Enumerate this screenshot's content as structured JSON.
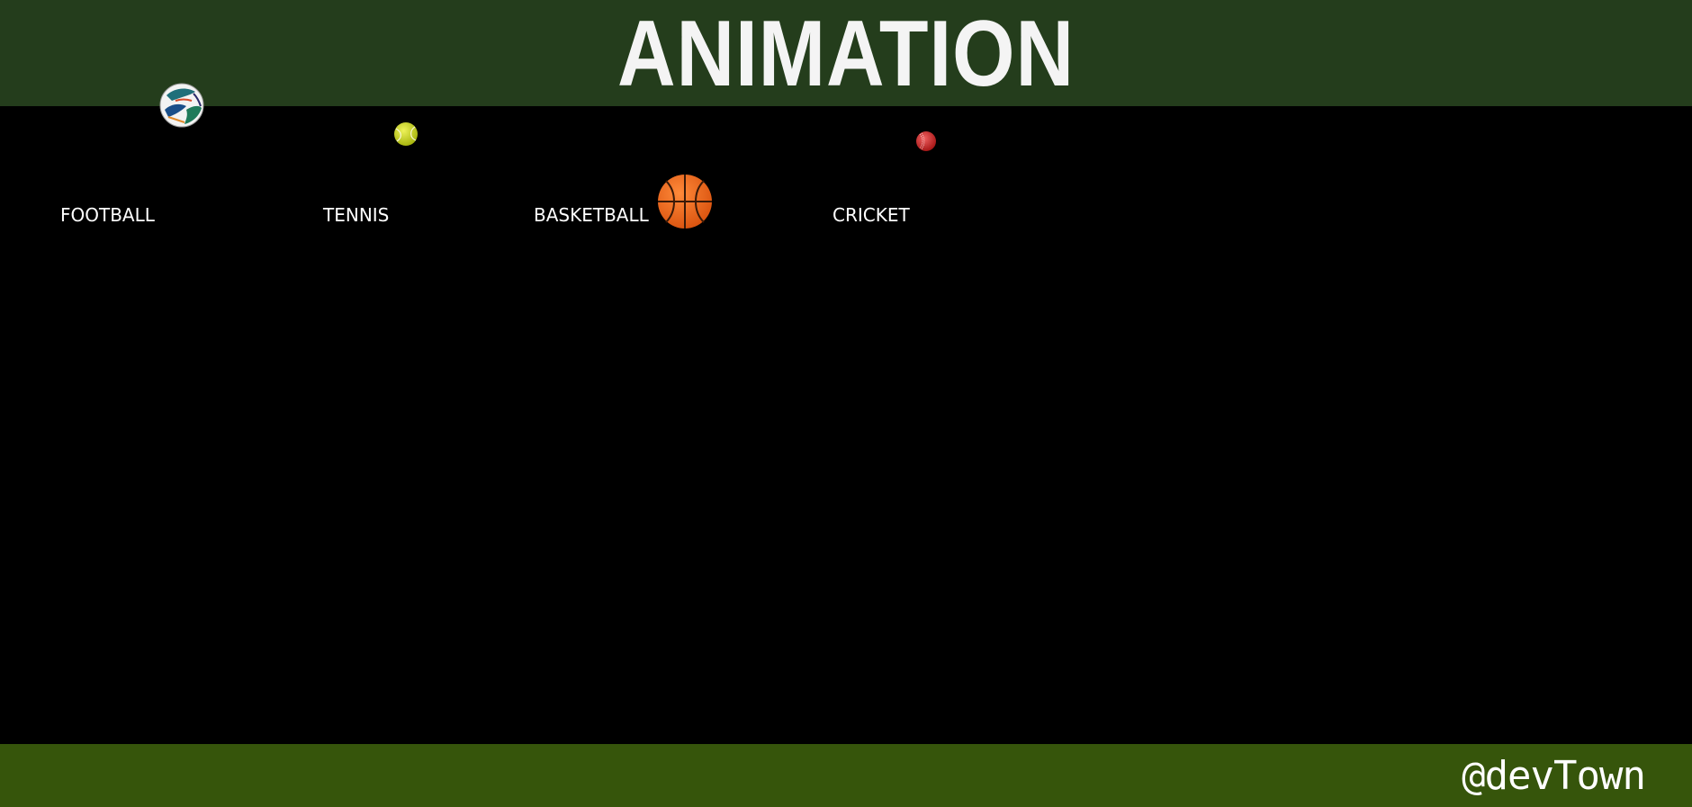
{
  "header": {
    "title": "ANIMATION",
    "background_color": "#243d1c"
  },
  "sports": [
    {
      "label": "FOOTBALL",
      "icon": "football-ball-icon"
    },
    {
      "label": "TENNIS",
      "icon": "tennis-ball-icon"
    },
    {
      "label": "BASKETBALL",
      "icon": "basketball-icon"
    },
    {
      "label": "CRICKET",
      "icon": "cricket-ball-icon"
    }
  ],
  "footer": {
    "brand": "@devTown",
    "background_color": "#36550b"
  },
  "colors": {
    "page_background": "#000000",
    "text": "#ffffff",
    "title_text": "#f4f4f4",
    "tennis_ball": "#c8d617",
    "basketball": "#f26a1b",
    "cricket_ball": "#d32a2a"
  }
}
